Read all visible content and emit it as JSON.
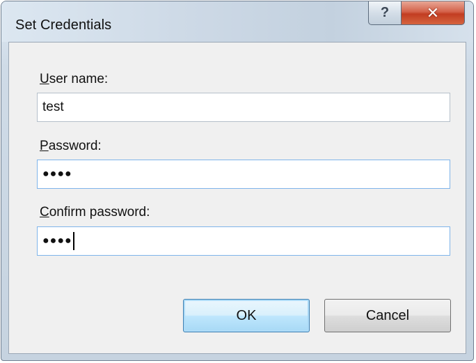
{
  "window": {
    "title": "Set Credentials",
    "help_glyph": "?",
    "close_glyph": "✕"
  },
  "fields": {
    "username": {
      "label_mnemonic": "U",
      "label_rest": "ser name:",
      "value": "test"
    },
    "password": {
      "label_mnemonic": "P",
      "label_rest": "assword:",
      "masked_value": "●●●●"
    },
    "confirm": {
      "label_mnemonic": "C",
      "label_rest": "onfirm password:",
      "masked_value": "●●●●"
    }
  },
  "buttons": {
    "ok_label": "OK",
    "cancel_label": "Cancel"
  },
  "icons": {
    "help": "help-icon",
    "close": "close-icon"
  },
  "colors": {
    "close_button": "#c23d22",
    "focus_border": "#7eb4ea",
    "default_button_border": "#3c7fb1",
    "client_background": "#f0f0f0"
  }
}
